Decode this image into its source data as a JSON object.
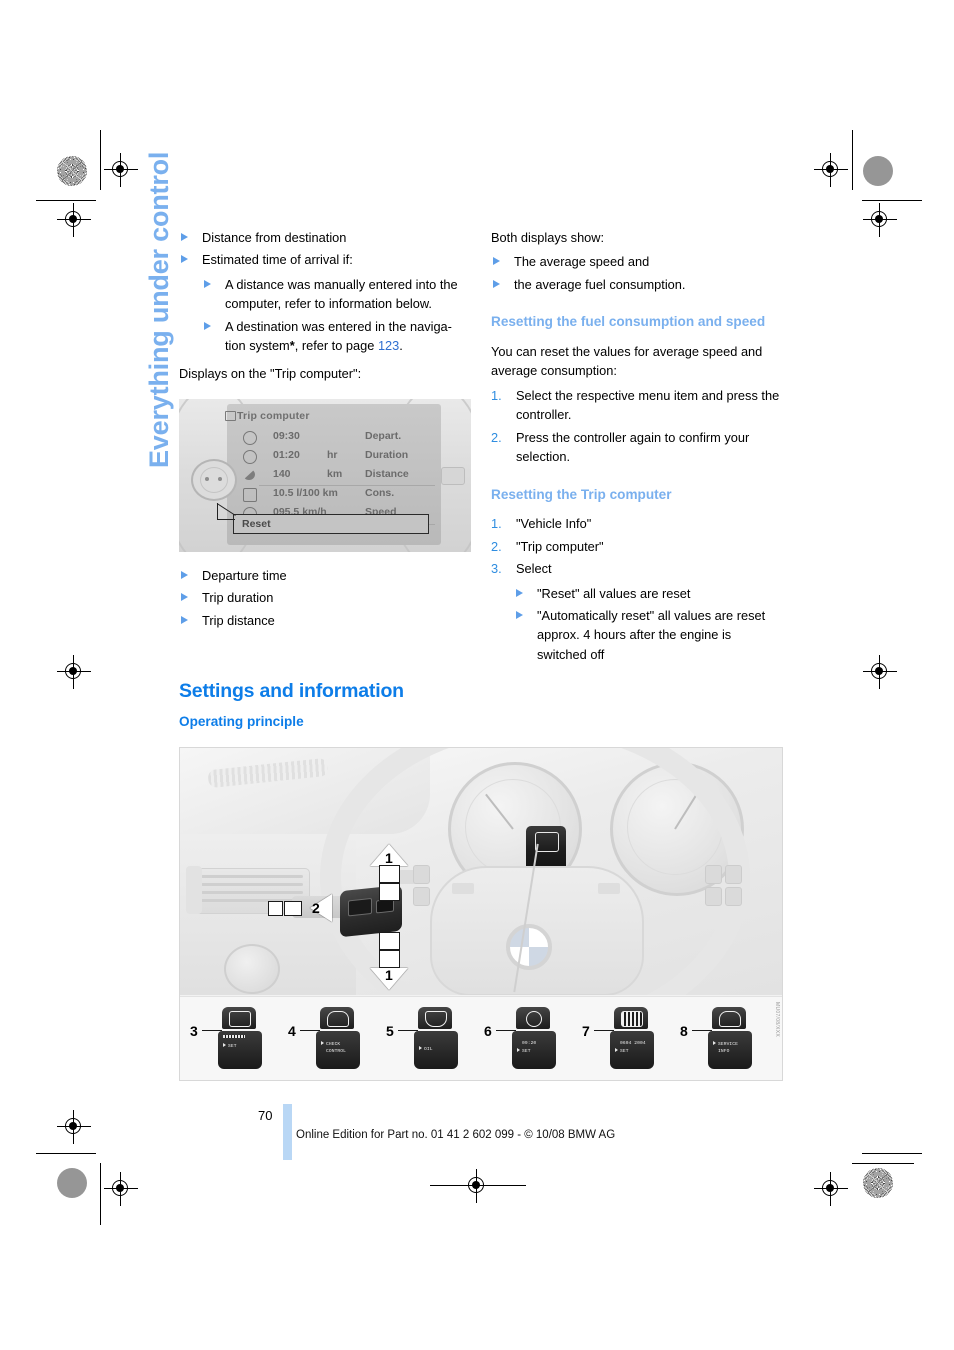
{
  "page": {
    "chapter_tab": "Everything under control",
    "folio": "70",
    "footer_note": "Online Edition for Part no. 01 41 2 602 099 - © 10/08 BMW AG",
    "colors": {
      "heading_blue": "#0d7de8",
      "subheading_blue": "#7ab0ee",
      "bullet_blue": "#5e9ee8",
      "number_blue": "#2f8de0",
      "link_blue": "#2f6fd0",
      "tab_blue": "#7ab0ee",
      "folio_bar": "#b9d7f5"
    }
  },
  "left_column": {
    "top_bullets": [
      "Distance from destination",
      "Estimated time of arrival if:"
    ],
    "sub_bullets": [
      "A distance was manually entered into the computer, refer to information below.",
      "A destination was entered in the navigation system*, refer to page 123."
    ],
    "sub_bullet_2_prefix": "A destination was entered in the naviga-tion system",
    "sub_bullet_2_star": "*",
    "sub_bullet_2_mid": ", refer to page ",
    "sub_bullet_2_link": "123",
    "sub_bullet_2_suffix": ".",
    "displays_intro": "Displays on the \"Trip computer\":",
    "below_figure_bullets": [
      "Departure time",
      "Trip duration",
      "Trip distance"
    ],
    "section_heading": "Settings and information",
    "sub_heading": "Operating principle"
  },
  "right_column": {
    "both_displays_intro": "Both displays show:",
    "both_displays_bullets": [
      "The average speed and",
      "the average fuel consumption."
    ],
    "heading_reset_fuel": "Resetting the fuel consumption and speed",
    "reset_fuel_intro": "You can reset the values for average speed and average consumption:",
    "reset_fuel_steps": [
      "Select the respective menu item and press the controller.",
      "Press the controller again to confirm your selection."
    ],
    "heading_reset_trip": "Resetting the Trip computer",
    "reset_trip_steps": [
      "\"Vehicle Info\"",
      "\"Trip computer\"",
      "Select"
    ],
    "reset_trip_sub_bullets": [
      "\"Reset\" all values are reset",
      "\"Automatically reset\" all values are reset approx. 4 hours after the engine is switched off"
    ]
  },
  "trip_computer_figure": {
    "title": "Trip computer",
    "rows": [
      {
        "icon": "departure-clock-icon",
        "value": "09:30",
        "unit": "",
        "label": "Depart."
      },
      {
        "icon": "stopwatch-icon",
        "value": "01:20",
        "unit": "hr",
        "label": "Duration"
      },
      {
        "icon": "distance-icon",
        "value": "140",
        "unit": "km",
        "label": "Distance"
      },
      {
        "icon": "fuel-pump-icon",
        "value": "10.5 l/100 km",
        "unit": "",
        "label": "Cons."
      },
      {
        "icon": "speedometer-icon",
        "value": "095.5 km/h",
        "unit": "",
        "label": "Speed"
      }
    ],
    "reset_button": "Reset"
  },
  "dashboard_figure": {
    "callouts": [
      {
        "num": "1",
        "desc": "rocker-up"
      },
      {
        "num": "2",
        "desc": "stalk-button"
      },
      {
        "num": "1",
        "desc": "rocker-down"
      }
    ],
    "buttons": [
      {
        "num": "3",
        "top_icon": "settings-gear-icon",
        "display_line1": "▮▮▮▯▯▯▯▯",
        "display_line2": "SET"
      },
      {
        "num": "4",
        "top_icon": "car-icon",
        "display_line1": "CHECK",
        "display_line2": "CONTROL"
      },
      {
        "num": "5",
        "top_icon": "oil-can-icon",
        "display_line1": "",
        "display_line2": "OIL"
      },
      {
        "num": "6",
        "top_icon": "clock-icon",
        "display_line1": "09:20",
        "display_line2": "SET"
      },
      {
        "num": "7",
        "top_icon": "date-display-icon",
        "display_line1": "0604 2004",
        "display_line2": "SET"
      },
      {
        "num": "8",
        "top_icon": "car-icon",
        "display_line1": "SERVICE",
        "display_line2": "INFO"
      }
    ],
    "illustration_code": "MU07/08/XXX"
  }
}
